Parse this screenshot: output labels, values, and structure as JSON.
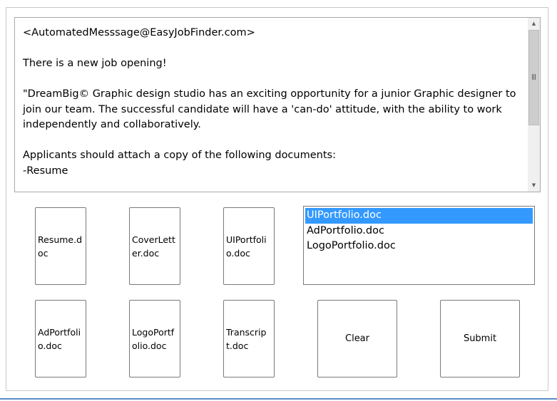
{
  "message": {
    "text": "<AutomatedMesssage@EasyJobFinder.com>\n\nThere is a new job opening!\n\n\"DreamBig© Graphic design studio has an exciting opportunity for a junior Graphic designer to join our team. The successful candidate will have a 'can-do' attitude, with the ability to work independently and collaboratively.\n\nApplicants should attach a copy of the following documents:\n-Resume"
  },
  "documents": {
    "tiles": [
      {
        "label": "Resume.doc"
      },
      {
        "label": "CoverLetter.doc"
      },
      {
        "label": "UIPortfolio.doc"
      },
      {
        "label": "AdPortfolio.doc"
      },
      {
        "label": "LogoPortfolio.doc"
      },
      {
        "label": "Transcript.doc"
      }
    ]
  },
  "selected_list": {
    "items": [
      "UIPortfolio.doc",
      "AdPortfolio.doc",
      "LogoPortfolio.doc"
    ],
    "selected_index": 0
  },
  "buttons": {
    "clear_label": "Clear",
    "submit_label": "Submit"
  },
  "colors": {
    "selection": "#3399ff",
    "window_border": "#c8c8c8",
    "accent_line": "#5b8fc9"
  }
}
